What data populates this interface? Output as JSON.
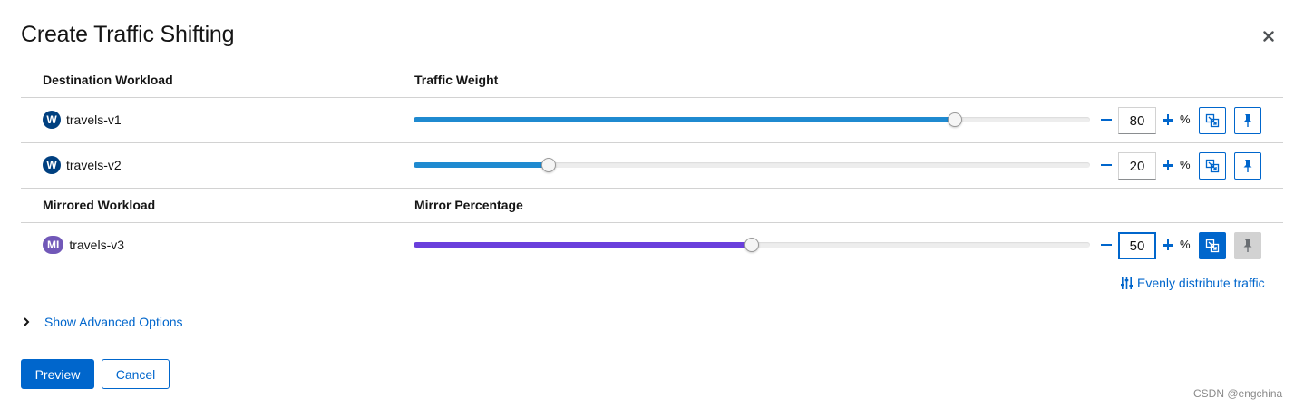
{
  "dialog": {
    "title": "Create Traffic Shifting"
  },
  "table": {
    "destination_header": "Destination Workload",
    "weight_header": "Traffic Weight",
    "mirrored_header": "Mirrored Workload",
    "mirror_pct_header": "Mirror Percentage",
    "rows": [
      {
        "badge": "W",
        "name": "travels-v1",
        "value": "80",
        "percent": 80
      },
      {
        "badge": "W",
        "name": "travels-v2",
        "value": "20",
        "percent": 20
      }
    ],
    "mirror": {
      "badge": "MI",
      "name": "travels-v3",
      "value": "50",
      "percent": 50
    },
    "unit": "%"
  },
  "actions": {
    "evenly_distribute": "Evenly distribute traffic",
    "show_advanced": "Show Advanced Options",
    "preview": "Preview",
    "cancel": "Cancel"
  },
  "watermark": "CSDN @engchina",
  "colors": {
    "accent": "#0066cc",
    "weight_fill": "#1f8ad0",
    "mirror_fill": "#6a3fdc",
    "workload_badge": "#004080",
    "mirror_badge": "#7158b8"
  },
  "icons": {
    "close": "close-icon",
    "mirror": "mirror-icon",
    "pin": "pin-icon",
    "distribute": "sliders-icon",
    "expand": "chevron-right-icon"
  }
}
